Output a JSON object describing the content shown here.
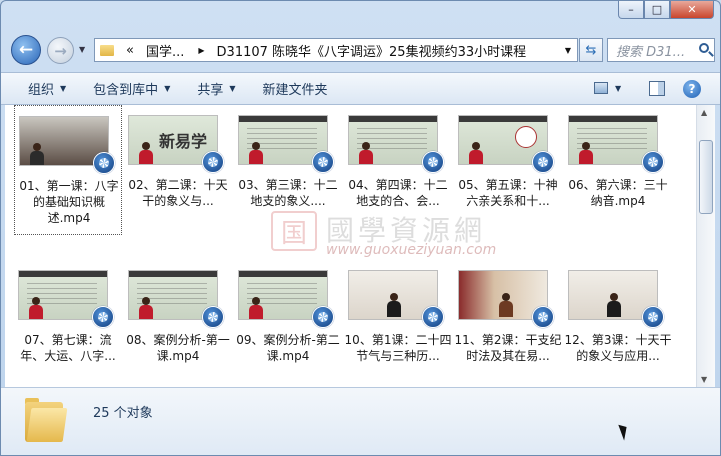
{
  "window": {
    "caption": {
      "minimize": "–",
      "maximize": "□",
      "close": "✕"
    }
  },
  "nav": {
    "back_icon": "back-arrow-icon",
    "forward_icon": "forward-arrow-icon",
    "address": {
      "overflow": "«",
      "segment1": "国学...",
      "sep": "▶",
      "segment2": "D31107 陈晓华《八字调运》25集视频约33小时课程"
    },
    "search_placeholder": "搜索 D31..."
  },
  "toolbar": {
    "organize": "组织",
    "include": "包含到库中",
    "share": "共享",
    "new_folder": "新建文件夹"
  },
  "files": [
    {
      "label": "01、第一课：八字的基础知识概述.mp4",
      "selected": true
    },
    {
      "label": "02、第二课：十天干的象义与..."
    },
    {
      "label": "03、第三课：十二地支的象义...."
    },
    {
      "label": "04、第四课：十二地支的合、会..."
    },
    {
      "label": "05、第五课：十神六亲关系和十..."
    },
    {
      "label": "06、第六课：三十纳音.mp4"
    },
    {
      "label": "07、第七课：流年、大运、八字..."
    },
    {
      "label": "08、案例分析-第一课.mp4"
    },
    {
      "label": "09、案例分析-第二课.mp4"
    },
    {
      "label": "10、第1课：二十四节气与三种历..."
    },
    {
      "label": "11、第2课：干支纪时法及其在易..."
    },
    {
      "label": "12、第3课：十天干的象义与应用..."
    }
  ],
  "thumb_chars": {
    "t2": "新易学"
  },
  "watermark": {
    "logo": "国",
    "title": "國學資源網",
    "url": "www.guoxueziyuan.com"
  },
  "details": {
    "count": "25 个对象"
  }
}
